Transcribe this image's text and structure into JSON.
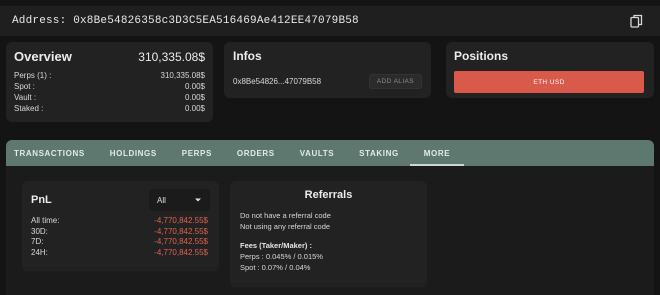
{
  "header": {
    "address": "Address: 0x8Be54826358c3D3C5EA516469Ae412EE47079B58",
    "copy_icon": "copy-icon"
  },
  "overview": {
    "title": "Overview",
    "total": "310,335.08$",
    "rows": [
      {
        "label": "Perps (1) :",
        "value": "310,335.08$"
      },
      {
        "label": "Spot :",
        "value": "0.00$"
      },
      {
        "label": "Vault :",
        "value": "0.00$"
      },
      {
        "label": "Staked :",
        "value": "0.00$"
      }
    ]
  },
  "infos": {
    "title": "Infos",
    "address_short": "0x8Be54826...47079B58",
    "alias_button": "ADD ALIAS"
  },
  "positions": {
    "title": "Positions",
    "button": "ETH USD",
    "button_color": "#d9594b"
  },
  "tabs": [
    {
      "label": "TRANSACTIONS"
    },
    {
      "label": "HOLDINGS"
    },
    {
      "label": "PERPS"
    },
    {
      "label": "ORDERS"
    },
    {
      "label": "VAULTS"
    },
    {
      "label": "STAKING"
    },
    {
      "label": "MORE",
      "active": true
    }
  ],
  "pnl": {
    "title": "PnL",
    "select_value": "All",
    "rows": [
      {
        "label": "All time:",
        "value": "-4,770,842.55$"
      },
      {
        "label": "30D:",
        "value": "-4,770,842.55$"
      },
      {
        "label": "7D:",
        "value": "-4,770,842.55$"
      },
      {
        "label": "24H:",
        "value": "-4,770,842.55$"
      }
    ],
    "negative_color": "#e0604f"
  },
  "referrals": {
    "title": "Referrals",
    "line1": "Do not have a referral code",
    "line2": "Not using any referral code",
    "fees_title": "Fees (Taker/Maker) :",
    "fees_perps": "Perps :  0.045% / 0.015%",
    "fees_spot": "Spot :  0.07% / 0.04%"
  },
  "colors": {
    "background": "#141414",
    "card": "#222222",
    "tabbar": "#5e7870"
  }
}
